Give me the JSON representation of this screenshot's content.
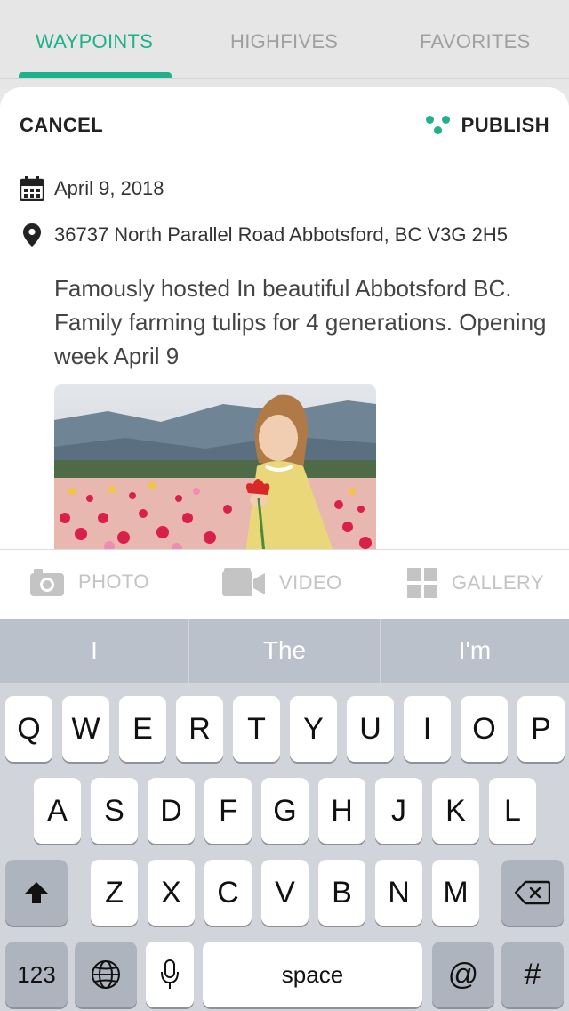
{
  "tabs": [
    {
      "label": "WAYPOINTS",
      "active": true
    },
    {
      "label": "HIGHFIVES",
      "active": false
    },
    {
      "label": "FAVORITES",
      "active": false
    }
  ],
  "composer": {
    "cancel_label": "CANCEL",
    "publish_label": "PUBLISH",
    "date": "April 9, 2018",
    "address": "36737 North Parallel Road Abbotsford, BC V3G 2H5",
    "description": "Famously hosted In beautiful Abbotsford BC. Family farming tulips for 4 generations. Opening week April 9"
  },
  "media": {
    "photo_label": "PHOTO",
    "video_label": "VIDEO",
    "gallery_label": "GALLERY"
  },
  "keyboard": {
    "suggestions": [
      "I",
      "The",
      "I'm"
    ],
    "row1": [
      "Q",
      "W",
      "E",
      "R",
      "T",
      "Y",
      "U",
      "I",
      "O",
      "P"
    ],
    "row2": [
      "A",
      "S",
      "D",
      "F",
      "G",
      "H",
      "J",
      "K",
      "L"
    ],
    "row3": [
      "Z",
      "X",
      "C",
      "V",
      "B",
      "N",
      "M"
    ],
    "numbers_label": "123",
    "space_label": "space",
    "at_label": "@",
    "hash_label": "#"
  },
  "colors": {
    "accent": "#1fb28a",
    "keyboard_bg": "#d1d5db",
    "suggestion_bar": "#bbc1ca"
  }
}
